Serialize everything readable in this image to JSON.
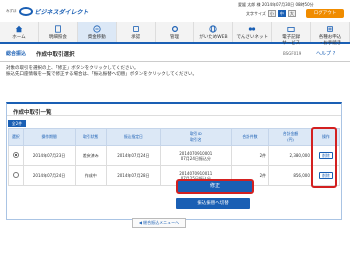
{
  "header": {
    "logo_text": "ビジネスダイレクト",
    "logo_sub": "みずほ",
    "user_line": "愛媛 太郎 様  2014年07月30日 08時50分",
    "font_size_label": "文字サイズ",
    "font_sizes": [
      "小",
      "中",
      "大"
    ],
    "logout": "ログアウト"
  },
  "nav": [
    {
      "label": "ホーム",
      "icon": "home-icon"
    },
    {
      "label": "明細照会",
      "icon": "document-icon"
    },
    {
      "label": "資金移動",
      "icon": "transfer-icon",
      "active": true
    },
    {
      "label": "承認",
      "icon": "stamp-icon"
    },
    {
      "label": "管理",
      "icon": "gear-icon"
    },
    {
      "label": "がいためWEB",
      "icon": "globe-icon"
    },
    {
      "label": "でんさいネット",
      "icon": "network-icon"
    },
    {
      "label": "電子記録\nサービス",
      "icon": "record-icon"
    },
    {
      "label": "各種お申込\n・お手続き",
      "icon": "form-icon"
    }
  ],
  "page": {
    "category": "総合振込",
    "title": "作成中取引選択",
    "code": "BSGF019",
    "help": "ヘルプ"
  },
  "instructions": [
    "対象の取引を選択の上、「修正」ボタンをクリックしてください。",
    "振込先口座情報を一覧で修正する場合は、「振込振替へ切替」ボタンをクリックしてください。"
  ],
  "section": {
    "title": "作成中取引一覧",
    "count": "全2件"
  },
  "table": {
    "headers": [
      "選択",
      "操作期間",
      "取引状態",
      "振込指定日",
      "取引ID\n取引名",
      "合計件数",
      "合計金額\n(円)",
      "操作"
    ],
    "rows": [
      {
        "selected": true,
        "date": "2014年07月23日",
        "status": "差戻済み",
        "transfer_date": "2014年07月24日",
        "tx_id": "2014070910001\n07月24日振込分",
        "count": "2件",
        "amount": "2,380,000",
        "action": "削除"
      },
      {
        "selected": false,
        "date": "2014年07月24日",
        "status": "作成中",
        "transfer_date": "2014年07月28日",
        "tx_id": "2014070910011\n07月25日振込分",
        "count": "2件",
        "amount": "856,000",
        "action": "削除"
      }
    ]
  },
  "buttons": {
    "back": "総合振込メニューへ",
    "fix": "修正",
    "switch": "振込振替へ切替"
  },
  "colors": {
    "primary": "#1a5fb4",
    "highlight": "#d32020",
    "logout": "#f08c00"
  }
}
